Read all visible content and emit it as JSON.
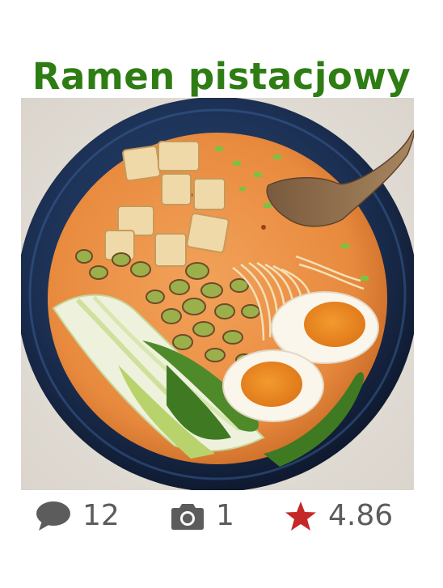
{
  "recipe": {
    "title": "Ramen pistacjowy",
    "image_alt": "Ramen pistacjowy"
  },
  "stats": {
    "comments_count": "12",
    "photos_count": "1",
    "rating": "4.86",
    "comments_icon": "comment-icon",
    "photos_icon": "camera-icon",
    "rating_icon": "star-icon"
  },
  "colors": {
    "title": "#2e7d14",
    "stat_text": "#5c5c5c",
    "icon_gray": "#5c5c5c",
    "star_red": "#c62828"
  }
}
